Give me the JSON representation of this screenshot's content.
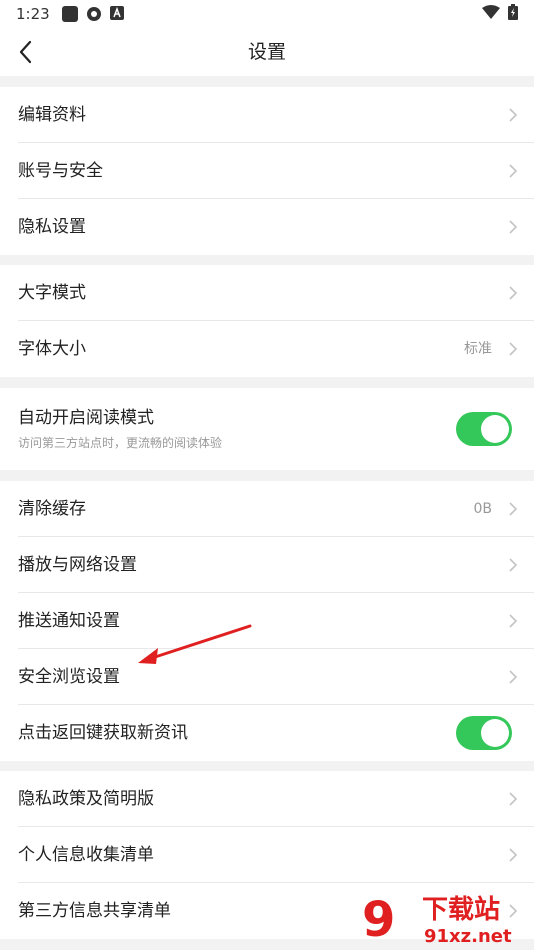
{
  "status": {
    "time": "1:23"
  },
  "header": {
    "title": "设置"
  },
  "groups": [
    {
      "items": [
        {
          "label": "编辑资料"
        },
        {
          "label": "账号与安全"
        },
        {
          "label": "隐私设置"
        }
      ]
    },
    {
      "items": [
        {
          "label": "大字模式"
        },
        {
          "label": "字体大小",
          "value": "标准"
        }
      ]
    },
    {
      "items": [
        {
          "label": "自动开启阅读模式",
          "sub": "访问第三方站点时，更流畅的阅读体验",
          "toggle": true
        }
      ]
    },
    {
      "items": [
        {
          "label": "清除缓存",
          "value": "0B"
        },
        {
          "label": "播放与网络设置"
        },
        {
          "label": "推送通知设置"
        },
        {
          "label": "安全浏览设置"
        },
        {
          "label": "点击返回键获取新资讯",
          "toggle": true
        }
      ]
    },
    {
      "items": [
        {
          "label": "隐私政策及简明版"
        },
        {
          "label": "个人信息收集清单"
        },
        {
          "label": "第三方信息共享清单"
        }
      ]
    }
  ],
  "watermark": {
    "brand": "下载站",
    "url": "91xz.net"
  },
  "colors": {
    "toggle_on": "#34c759",
    "annotation_arrow": "#e02020"
  }
}
